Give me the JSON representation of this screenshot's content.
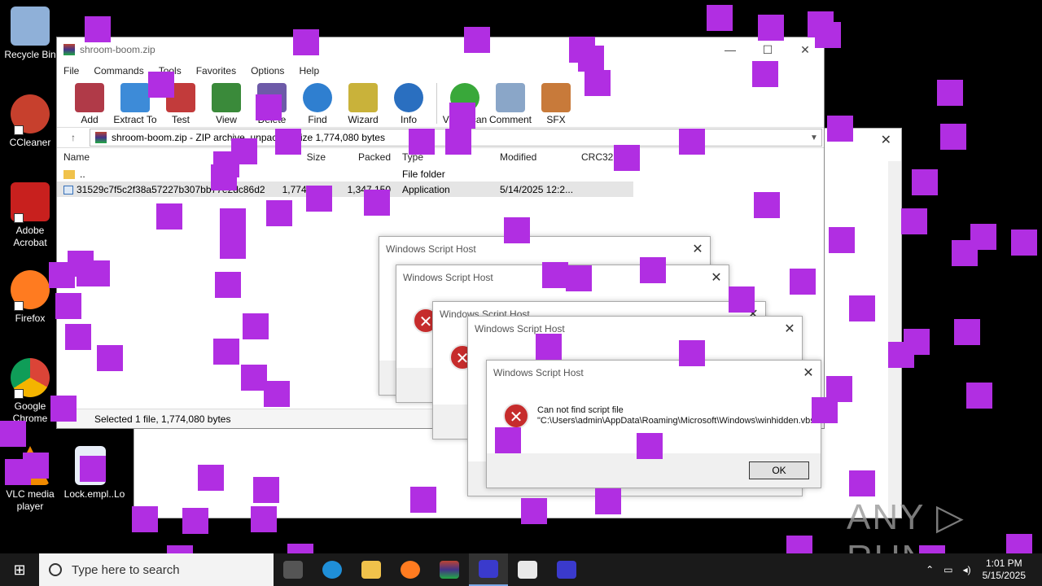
{
  "desktop_icons": [
    {
      "label": "Recycle Bin",
      "color": "#8fb0d8"
    },
    {
      "label": "CCleaner",
      "color": "#c7402d"
    },
    {
      "label": "Adobe Acrobat",
      "color": "#c8201e"
    },
    {
      "label": "Firefox",
      "color": "#ff7b20"
    },
    {
      "label": "Google Chrome",
      "color": "#2a9d47"
    },
    {
      "label": "VLC media player",
      "color": "#f08a00"
    },
    {
      "label": "Lock.empl...",
      "color": "#e8eef8"
    },
    {
      "label": "Lo",
      "color": "#ffffff"
    }
  ],
  "winrar": {
    "title": "shroom-boom.zip",
    "menu": [
      "File",
      "Commands",
      "Tools",
      "Favorites",
      "Options",
      "Help"
    ],
    "toolbar": [
      {
        "label": "Add",
        "color": "#b03a48"
      },
      {
        "label": "Extract To",
        "color": "#3d8bd8"
      },
      {
        "label": "Test",
        "color": "#c23b3b"
      },
      {
        "label": "View",
        "color": "#3a8a3a"
      },
      {
        "label": "Delete",
        "color": "#6d5aa8"
      },
      {
        "label": "Find",
        "color": "#2f7fd0"
      },
      {
        "label": "Wizard",
        "color": "#c9b23a"
      },
      {
        "label": "Info",
        "color": "#2a6fc0"
      },
      {
        "label": "VirusScan",
        "color": "#39a83a"
      },
      {
        "label": "Comment",
        "color": "#8aa6c8"
      },
      {
        "label": "SFX",
        "color": "#c87a3a"
      }
    ],
    "path_text": "shroom-boom.zip - ZIP archive, unpacked size 1,774,080 bytes",
    "columns": [
      "Name",
      "Size",
      "Packed",
      "Type",
      "Modified",
      "CRC32"
    ],
    "rows": [
      {
        "name": "..",
        "size": "",
        "packed": "",
        "type": "File folder",
        "modified": ""
      },
      {
        "name": "31529c7f5c2f38a57227b307bb77e2dc86d28...",
        "size": "1,774,080",
        "packed": "1,347,150",
        "type": "Application",
        "modified": "5/14/2025 12:2..."
      }
    ],
    "status": "Selected 1 file, 1,774,080 bytes"
  },
  "dialogs": {
    "title": "Windows Script Host",
    "message": "Can not find script file \"C:\\Users\\admin\\AppData\\Roaming\\Microsoft\\Windows\\winhidden.vbs\".",
    "ok_label": "OK",
    "close_glyph": "✕",
    "error_glyph": "✕"
  },
  "taskbar": {
    "search_placeholder": "Type here to search",
    "time": "1:01 PM",
    "date": "5/15/2025"
  },
  "watermark": "ANY ▷ RUN"
}
